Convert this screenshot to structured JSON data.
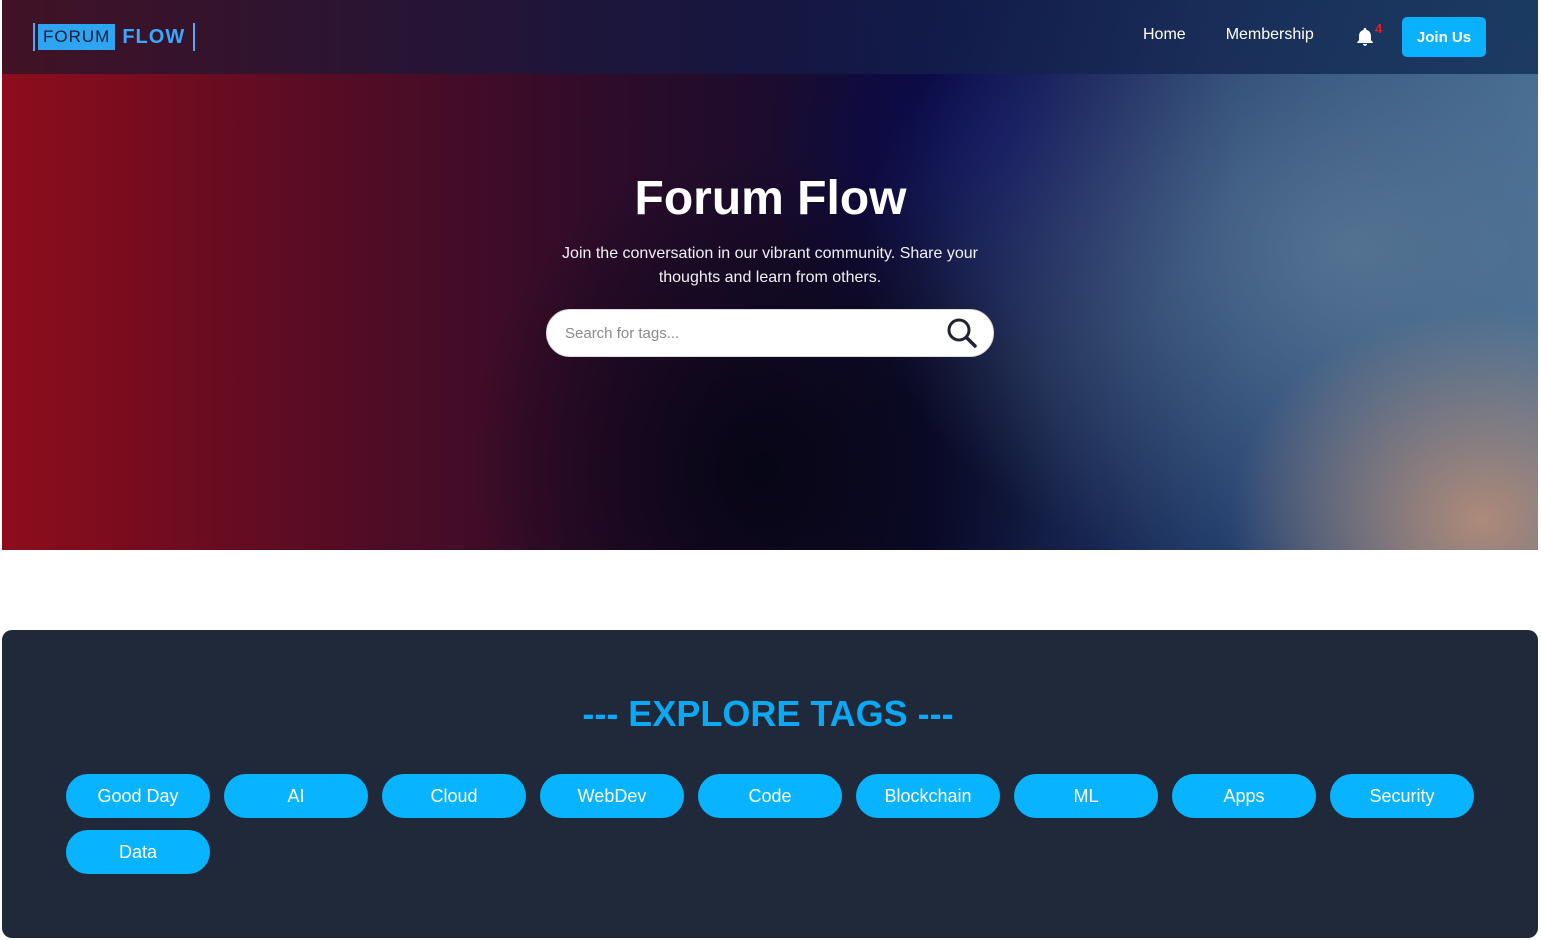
{
  "brand": {
    "logo_part1": "FORUM",
    "logo_part2": "FLOW"
  },
  "nav": {
    "links": [
      "Home",
      "Membership"
    ],
    "notification_icon": "bell-icon",
    "notification_count": "4",
    "join_label": "Join Us"
  },
  "hero": {
    "title": "Forum Flow",
    "subtitle": "Join the conversation in our vibrant community. Share your thoughts and learn from others.",
    "search_placeholder": "Search for tags...",
    "search_icon": "search-icon"
  },
  "tags_section": {
    "title": "--- EXPLORE TAGS ---",
    "tags": [
      "Good Day",
      "AI",
      "Cloud",
      "WebDev",
      "Code",
      "Blockchain",
      "ML",
      "Apps",
      "Security",
      "Data"
    ]
  },
  "colors": {
    "accent": "#0ab1ff",
    "panel_bg": "#1f2939",
    "notification": "#e02020"
  }
}
